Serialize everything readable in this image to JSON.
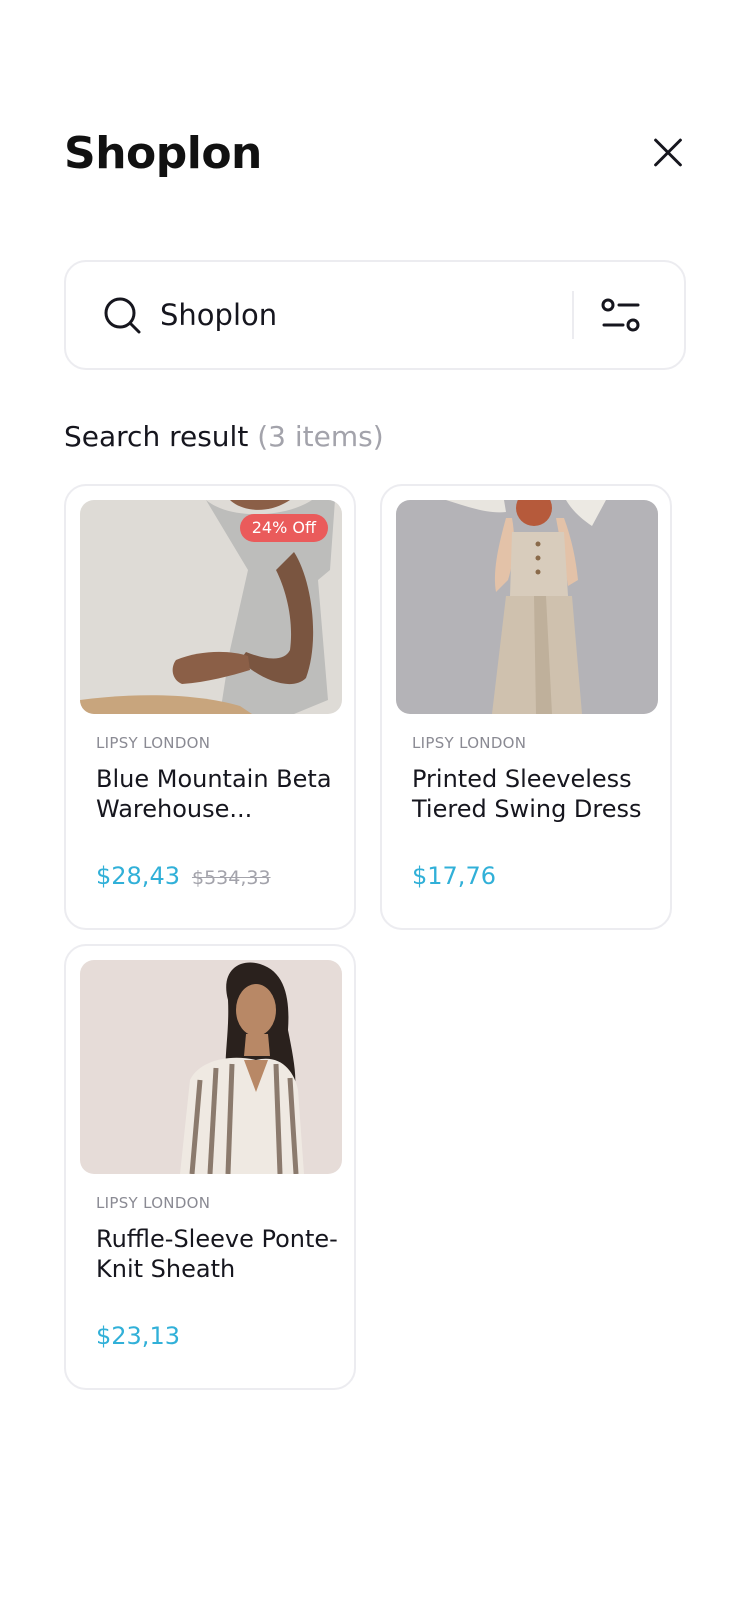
{
  "app": {
    "logo": "Shoplon"
  },
  "search": {
    "value": "Shoplon"
  },
  "results": {
    "title": "Search result",
    "count": "(3 items)"
  },
  "products": [
    {
      "badge": "24% Off",
      "brand": "LIPSY LONDON",
      "name": "Blue Mountain Beta Warehouse...",
      "price": "$28,43",
      "old_price": "$534,33"
    },
    {
      "badge": "",
      "brand": "LIPSY LONDON",
      "name": "Printed Sleeveless Tiered Swing Dress",
      "price": "$17,76",
      "old_price": ""
    },
    {
      "badge": "",
      "brand": "LIPSY LONDON",
      "name": "Ruffle-Sleeve Ponte-Knit Sheath",
      "price": "$23,13",
      "old_price": ""
    }
  ],
  "colors": {
    "accent": "#31b0d8",
    "badge": "#ea5b5b",
    "border": "#ececf0",
    "muted": "#a3a3ab"
  },
  "icons": [
    "close-icon",
    "search-icon",
    "filter-icon"
  ]
}
